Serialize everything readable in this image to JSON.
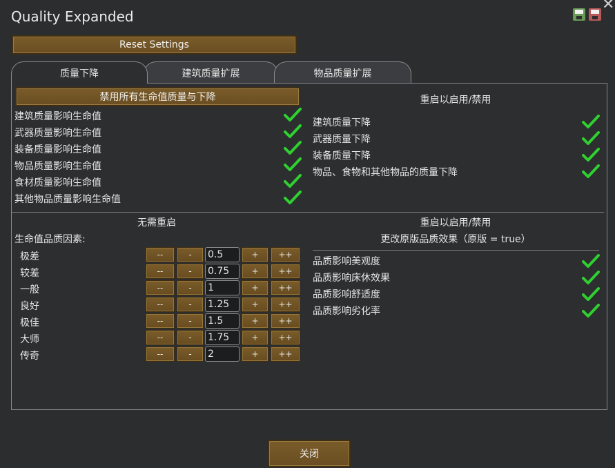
{
  "window": {
    "title": "Quality Expanded",
    "close_glyph": "✕"
  },
  "toolbar": {
    "reset_label": "Reset Settings",
    "save_icon": "save-icon",
    "load_icon": "load-icon"
  },
  "tabs": [
    {
      "label": "质量下降",
      "active": true
    },
    {
      "label": "建筑质量扩展",
      "active": false
    },
    {
      "label": "物品质量扩展",
      "active": false
    }
  ],
  "left_top": {
    "disable_all_label": "禁用所有生命值质量与下降",
    "items": [
      {
        "label": "建筑质量影响生命值",
        "checked": true
      },
      {
        "label": "武器质量影响生命值",
        "checked": true
      },
      {
        "label": "装备质量影响生命值",
        "checked": true
      },
      {
        "label": "物品质量影响生命值",
        "checked": true
      },
      {
        "label": "食材质量影响生命值",
        "checked": true
      },
      {
        "label": "其他物品质量影响生命值",
        "checked": true
      }
    ]
  },
  "right_top": {
    "header": "重启以启用/禁用",
    "items": [
      {
        "label": "建筑质量下降",
        "checked": true
      },
      {
        "label": "武器质量下降",
        "checked": true
      },
      {
        "label": "装备质量下降",
        "checked": true
      },
      {
        "label": "物品、食物和其他物品的质量下降",
        "checked": true
      }
    ]
  },
  "left_bottom": {
    "header": "无需重启",
    "subheader": "生命值品质因素:",
    "button_labels": {
      "dec_big": "--",
      "dec": "-",
      "inc": "+",
      "inc_big": "++"
    },
    "rows": [
      {
        "label": "极差",
        "value": "0.5"
      },
      {
        "label": "较差",
        "value": "0.75"
      },
      {
        "label": "一般",
        "value": "1"
      },
      {
        "label": "良好",
        "value": "1.25"
      },
      {
        "label": "极佳",
        "value": "1.5"
      },
      {
        "label": "大师",
        "value": "1.75"
      },
      {
        "label": "传奇",
        "value": "2"
      }
    ]
  },
  "right_bottom": {
    "header": "重启以启用/禁用",
    "subheader": "更改原版品质效果（原版 = true）",
    "items": [
      {
        "label": "品质影响美观度",
        "checked": true
      },
      {
        "label": "品质影响床休效果",
        "checked": true
      },
      {
        "label": "品质影响舒适度",
        "checked": true
      },
      {
        "label": "品质影响劣化率",
        "checked": true
      }
    ]
  },
  "footer": {
    "close_label": "关闭"
  },
  "colors": {
    "check": "#2fd12f",
    "button": "#725428",
    "panel": "#2d2e30",
    "border": "#8a8b8d"
  }
}
